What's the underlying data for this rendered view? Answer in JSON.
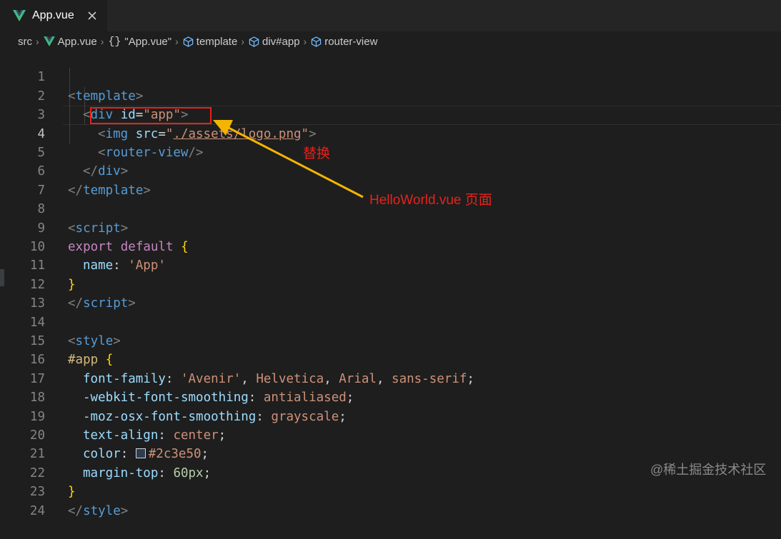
{
  "tab": {
    "label": "App.vue",
    "icon": "vue-icon",
    "close_icon": "close-icon"
  },
  "breadcrumb": {
    "items": [
      "src",
      "App.vue",
      "\"App.vue\"",
      "template",
      "div#app",
      "router-view"
    ],
    "braces": "{}"
  },
  "editor": {
    "line_numbers": [
      "1",
      "2",
      "3",
      "4",
      "5",
      "6",
      "7",
      "8",
      "9",
      "10",
      "11",
      "12",
      "13",
      "14",
      "15",
      "16",
      "17",
      "18",
      "19",
      "20",
      "21",
      "22",
      "23",
      "24"
    ],
    "active_line": "4",
    "code": {
      "l1_open": "<",
      "l1_tag": "template",
      "l1_close": ">",
      "l2_open": "<",
      "l2_tag": "div",
      "l2_attr": "id",
      "l2_eq": "=",
      "l2_val": "\"app\"",
      "l2_close": ">",
      "l3_open": "<",
      "l3_tag": "img",
      "l3_attr": "src",
      "l3_eq": "=",
      "l3_q1": "\"",
      "l3_path": "./assets/logo.png",
      "l3_q2": "\"",
      "l3_close": ">",
      "l4_open": "<",
      "l4_tag": "router-view",
      "l4_close": "/>",
      "l5_open": "</",
      "l5_tag": "div",
      "l5_close": ">",
      "l6_open": "</",
      "l6_tag": "template",
      "l6_close": ">",
      "l8_open": "<",
      "l8_tag": "script",
      "l8_close": ">",
      "l9_kw": "export default",
      "l9_brace": "{",
      "l10_prop": "name",
      "l10_colon": ": ",
      "l10_val": "'App'",
      "l11_brace": "}",
      "l12_open": "</",
      "l12_tag": "script",
      "l12_close": ">",
      "l14_open": "<",
      "l14_tag": "style",
      "l14_close": ">",
      "l15_sel": "#app",
      "l15_brace": "{",
      "l16_prop": "font-family",
      "l16_colon": ": ",
      "l16_v1": "'Avenir'",
      "l16_c1": ", ",
      "l16_v2": "Helvetica",
      "l16_c2": ", ",
      "l16_v3": "Arial",
      "l16_c3": ", ",
      "l16_v4": "sans-serif",
      "l16_semi": ";",
      "l17_prop": "-webkit-font-smoothing",
      "l17_colon": ": ",
      "l17_val": "antialiased",
      "l17_semi": ";",
      "l18_prop": "-moz-osx-font-smoothing",
      "l18_colon": ": ",
      "l18_val": "grayscale",
      "l18_semi": ";",
      "l19_prop": "text-align",
      "l19_colon": ": ",
      "l19_val": "center",
      "l19_semi": ";",
      "l20_prop": "color",
      "l20_colon": ": ",
      "l20_val": "#2c3e50",
      "l20_semi": ";",
      "l21_prop": "margin-top",
      "l21_colon": ": ",
      "l21_val": "60px",
      "l21_semi": ";",
      "l22_brace": "}",
      "l23_open": "</",
      "l23_tag": "style",
      "l23_close": ">"
    },
    "swatch_color": "#2c3e50"
  },
  "annotations": {
    "replace_label": "替换",
    "target_label": "HelloWorld.vue 页面",
    "highlight_color": "#e8211a",
    "arrow_color": "#f5b400"
  },
  "watermark": "@稀土掘金技术社区"
}
